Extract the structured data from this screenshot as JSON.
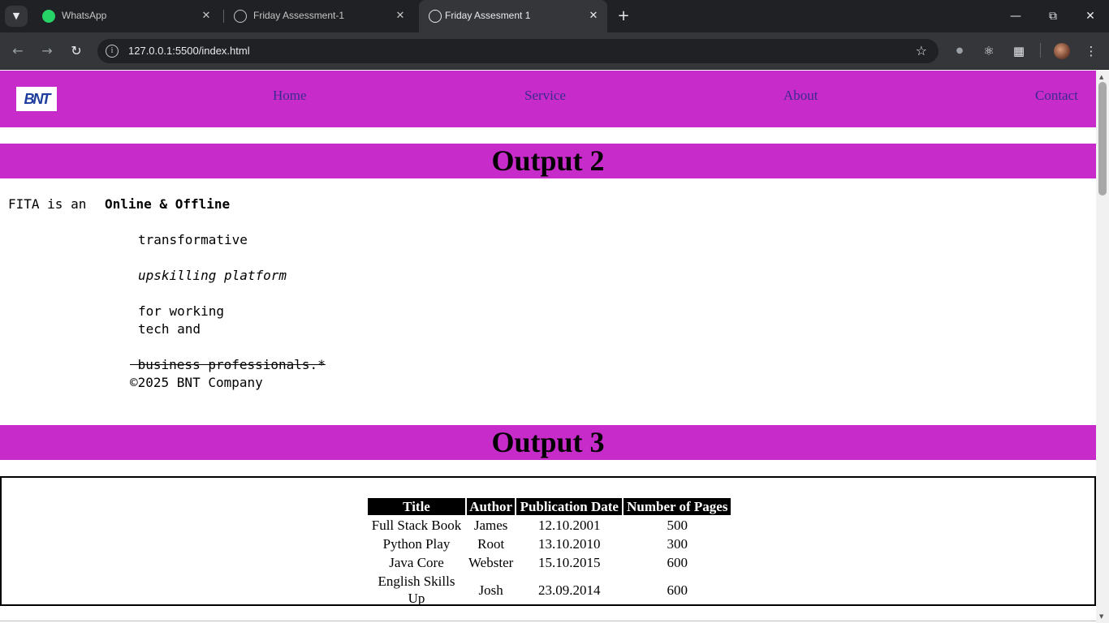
{
  "browser": {
    "tabs": [
      {
        "title": "WhatsApp"
      },
      {
        "title": "Friday Assessment-1"
      },
      {
        "title": "Friday Assesment 1"
      }
    ],
    "url": "127.0.0.1:5500/index.html"
  },
  "site": {
    "logo_text": "BNT",
    "nav": [
      "Home",
      "Service",
      "About",
      "Contact"
    ]
  },
  "output2": {
    "heading": "Output 2",
    "line1_prefix": "FITA is an",
    "line1_bold": "Online & Offline",
    "transformative": "transformative",
    "upskilling": "upskilling platform",
    "for_working": "for working",
    "tech_and": "tech and",
    "business": " business professionals.*",
    "copyright": "©2025 BNT Company"
  },
  "output3": {
    "heading": "Output 3",
    "table": {
      "headers": [
        "Title",
        "Author",
        "Publication Date",
        "Number of Pages"
      ],
      "rows": [
        [
          "Full Stack Book",
          "James",
          "12.10.2001",
          "500"
        ],
        [
          "Python Play",
          "Root",
          "13.10.2010",
          "300"
        ],
        [
          "Java Core",
          "Webster",
          "15.10.2015",
          "600"
        ],
        [
          "English Skills Up",
          "Josh",
          "23.09.2014",
          "600"
        ]
      ]
    }
  }
}
